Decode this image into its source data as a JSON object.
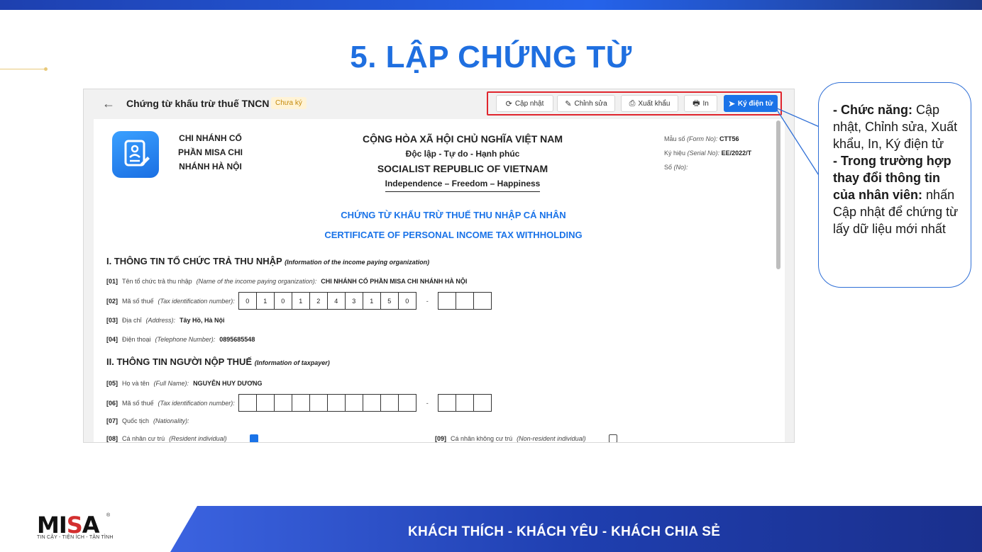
{
  "slide": {
    "title": "5. LẬP CHỨNG TỪ"
  },
  "app": {
    "header": {
      "back_icon": "←",
      "title": "Chứng từ khấu trừ thuế TNCN",
      "status": "Chưa ký"
    },
    "toolbar": {
      "update": "Cập nhật",
      "edit": "Chỉnh sửa",
      "export": "Xuất khẩu",
      "print": "In",
      "sign": "Ký điện tử"
    },
    "document": {
      "org_name": "CHI NHÁNH CỔ PHẦN MISA CHI NHÁNH HÀ NỘI",
      "nation_line1": "CỘNG HÒA XÃ HỘI CHỦ NGHĨA VIỆT NAM",
      "nation_line2": "Độc lập - Tự do - Hạnh phúc",
      "nation_line3": "SOCIALIST REPUBLIC OF VIETNAM",
      "nation_line4": "Independence – Freedom – Happiness",
      "form_no_label": "Mẫu số",
      "form_no_en": "(Form No):",
      "form_no": "CTT56",
      "serial_label": "Ký hiệu",
      "serial_en": "(Serial No):",
      "serial_no": "EE/2022/T",
      "no_label": "Số",
      "no_en": "(No):",
      "cert_title_vi": "CHỨNG TỪ KHẤU TRỪ THUẾ THU NHẬP CÁ NHÂN",
      "cert_title_en": "CERTIFICATE OF PERSONAL INCOME TAX WITHHOLDING",
      "section1_title": "I. THÔNG TIN TỔ CHỨC TRẢ THU NHẬP",
      "section1_en": "(Information of the income paying organization)",
      "f01_code": "[01]",
      "f01_label": "Tên tổ chức trả thu nhập",
      "f01_en": "(Name of the income paying organization):",
      "f01_value": "CHI NHÁNH CỔ PHẦN MISA CHI NHÁNH HÀ NỘI",
      "f02_code": "[02]",
      "f02_label": "Mã số thuế",
      "f02_en": "(Tax identification number):",
      "f02_digits": [
        "0",
        "1",
        "0",
        "1",
        "2",
        "4",
        "3",
        "1",
        "5",
        "0"
      ],
      "f02_suffix": [
        "",
        "",
        ""
      ],
      "f03_code": "[03]",
      "f03_label": "Địa chỉ",
      "f03_en": "(Address):",
      "f03_value": "Tây Hồ, Hà Nội",
      "f04_code": "[04]",
      "f04_label": "Điện thoại",
      "f04_en": "(Telephone Number):",
      "f04_value": "0895685548",
      "section2_title": "II. THÔNG TIN NGƯỜI NỘP THUẾ",
      "section2_en": "(Information of taxpayer)",
      "f05_code": "[05]",
      "f05_label": "Họ và tên",
      "f05_en": "(Full Name):",
      "f05_value": "NGUYỄN HUY DƯƠNG",
      "f06_code": "[06]",
      "f06_label": "Mã số thuế",
      "f06_en": "(Tax identification number):",
      "f07_code": "[07]",
      "f07_label": "Quốc tịch",
      "f07_en": "(Nationality):",
      "f08_code": "[08]",
      "f08_label": "Cá nhân cư trú",
      "f08_en": "(Resident individual)",
      "f09_code": "[09]",
      "f09_label": "Cá nhân không cư trú",
      "f09_en": "(Non-resident individual)"
    }
  },
  "callout": {
    "func_label": "- Chức năng:",
    "func_text": "Cập nhật, Chỉnh sửa, Xuất khẩu, In, Ký điện tử",
    "case_label": "- Trong trường hợp thay đổi thông tin của nhân viên:",
    "case_text": "nhấn Cập nhật để chứng từ lấy dữ liệu mới nhất"
  },
  "footer": {
    "slogan": "KHÁCH THÍCH - KHÁCH YÊU - KHÁCH CHIA SẺ",
    "logo_m": "MI",
    "logo_s": "S",
    "logo_a": "A",
    "logo_reg": "®",
    "logo_tagline": "TIN CẬY - TIỆN ÍCH - TẬN TÌNH"
  },
  "colors": {
    "accent": "#1f6fe0",
    "primary_button": "#1a73e8",
    "highlight_frame": "#e0252d",
    "footer_band": "#1f3fb0"
  }
}
